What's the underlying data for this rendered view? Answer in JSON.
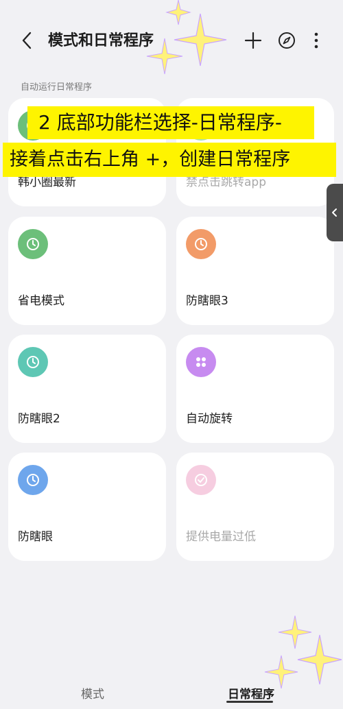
{
  "header": {
    "title": "模式和日常程序",
    "icons": [
      "back-arrow-icon",
      "plus-icon",
      "compass-icon",
      "more-vertical-icon"
    ]
  },
  "section_label": "自动运行日常程序",
  "overlay": {
    "line1": "2 底部功能栏选择-日常程序-",
    "line2": "接着点击右上角 +，创建日常程序",
    "highlight_color": "#fef400"
  },
  "routines": [
    {
      "label": "韩小圈最新",
      "icon": "clock-icon",
      "color": "#6cbf7a",
      "enabled": true
    },
    {
      "label": "禁点击跳转app",
      "icon": "check-circle-icon",
      "color": "#a7dfb5",
      "enabled": false
    },
    {
      "label": "省电模式",
      "icon": "clock-icon",
      "color": "#6cbf7a",
      "enabled": true
    },
    {
      "label": "防瞎眼3",
      "icon": "clock-icon",
      "color": "#f29b68",
      "enabled": true
    },
    {
      "label": "防瞎眼2",
      "icon": "clock-icon",
      "color": "#5ec7b4",
      "enabled": true
    },
    {
      "label": "自动旋转",
      "icon": "grid-dots-icon",
      "color": "#c78bf0",
      "enabled": true
    },
    {
      "label": "防瞎眼",
      "icon": "clock-icon",
      "color": "#6ea6ec",
      "enabled": true
    },
    {
      "label": "提供电量过低",
      "icon": "check-circle-icon",
      "color": "#f6cde0",
      "enabled": false
    }
  ],
  "bottom_nav": {
    "items": [
      {
        "label": "模式",
        "active": false
      },
      {
        "label": "日常程序",
        "active": true
      }
    ]
  }
}
